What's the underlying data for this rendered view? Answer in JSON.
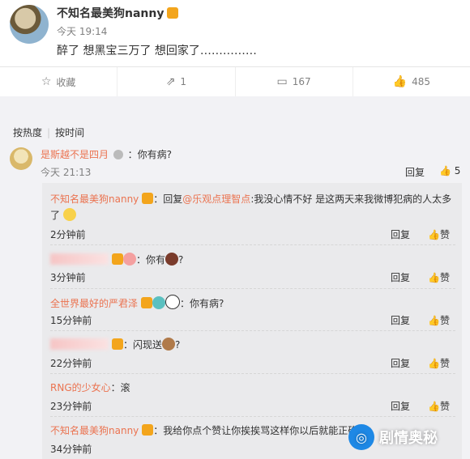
{
  "post": {
    "username": "不知名最美狗nanny",
    "time": "今天 19:14",
    "text": "醉了 想黑宝三万了 想回家了……………"
  },
  "actions": {
    "favorite": "收藏",
    "share": "1",
    "comments": "167",
    "likes": "485"
  },
  "sort": {
    "hot": "按热度",
    "time": "按时间"
  },
  "comment1": {
    "user": "是斯越不是四月",
    "text": "：你有病?",
    "time": "今天 21:13",
    "reply": "回复",
    "likes": "5"
  },
  "replies": [
    {
      "user": "不知名最美狗nanny",
      "reply_prefix": "：回复",
      "mention": "@乐观点理智点",
      "text": ":我没心情不好 是这两天来我微博犯病的人太多了",
      "time": "2分钟前",
      "reply": "回复",
      "like": "赞"
    },
    {
      "user": "",
      "text": "：你有",
      "text2": "?",
      "time": "3分钟前",
      "reply": "回复",
      "like": "赞"
    },
    {
      "user": "全世界最好的严君泽",
      "text": "：你有病?",
      "time": "15分钟前",
      "reply": "回复",
      "like": "赞"
    },
    {
      "user": "",
      "text": "：闪现送",
      "text2": "?",
      "time": "22分钟前",
      "reply": "回复",
      "like": "赞"
    },
    {
      "user": "RNG的少女心",
      "text": "：滚",
      "time": "23分钟前",
      "reply": "回复",
      "like": "赞"
    },
    {
      "user": "不知名最美狗nanny",
      "text": "：我给你点个赞让你挨挨骂这样你以后就能正确",
      "time": "34分钟前",
      "reply": "回复",
      "like": "赞"
    }
  ],
  "watermark": "剧情奥秘"
}
